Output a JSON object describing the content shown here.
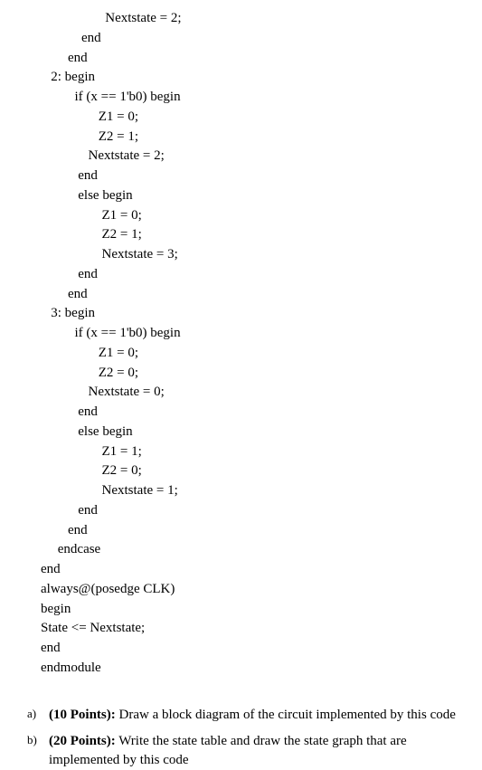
{
  "code": {
    "lines": [
      "                       Nextstate = 2;",
      "                end",
      "            end",
      "       2: begin",
      "              if (x == 1'b0) begin",
      "                     Z1 = 0;",
      "                     Z2 = 1;",
      "                  Nextstate = 2;",
      "               end",
      "               else begin",
      "                      Z1 = 0;",
      "                      Z2 = 1;",
      "                      Nextstate = 3;",
      "               end",
      "            end",
      "       3: begin",
      "              if (x == 1'b0) begin",
      "                     Z1 = 0;",
      "                     Z2 = 0;",
      "                  Nextstate = 0;",
      "               end",
      "               else begin",
      "                      Z1 = 1;",
      "                      Z2 = 0;",
      "                      Nextstate = 1;",
      "               end",
      "            end",
      "         endcase",
      "    end",
      "    always@(posedge CLK)",
      "    begin",
      "    State <= Nextstate;",
      "    end",
      "    endmodule"
    ]
  },
  "questions": {
    "a": {
      "letter": "a)",
      "points": "(10 Points):",
      "text": " Draw a block diagram of the circuit implemented by this code"
    },
    "b": {
      "letter": "b)",
      "points": "(20 Points):",
      "text": " Write the state table and draw the state graph that are implemented by this code"
    }
  }
}
